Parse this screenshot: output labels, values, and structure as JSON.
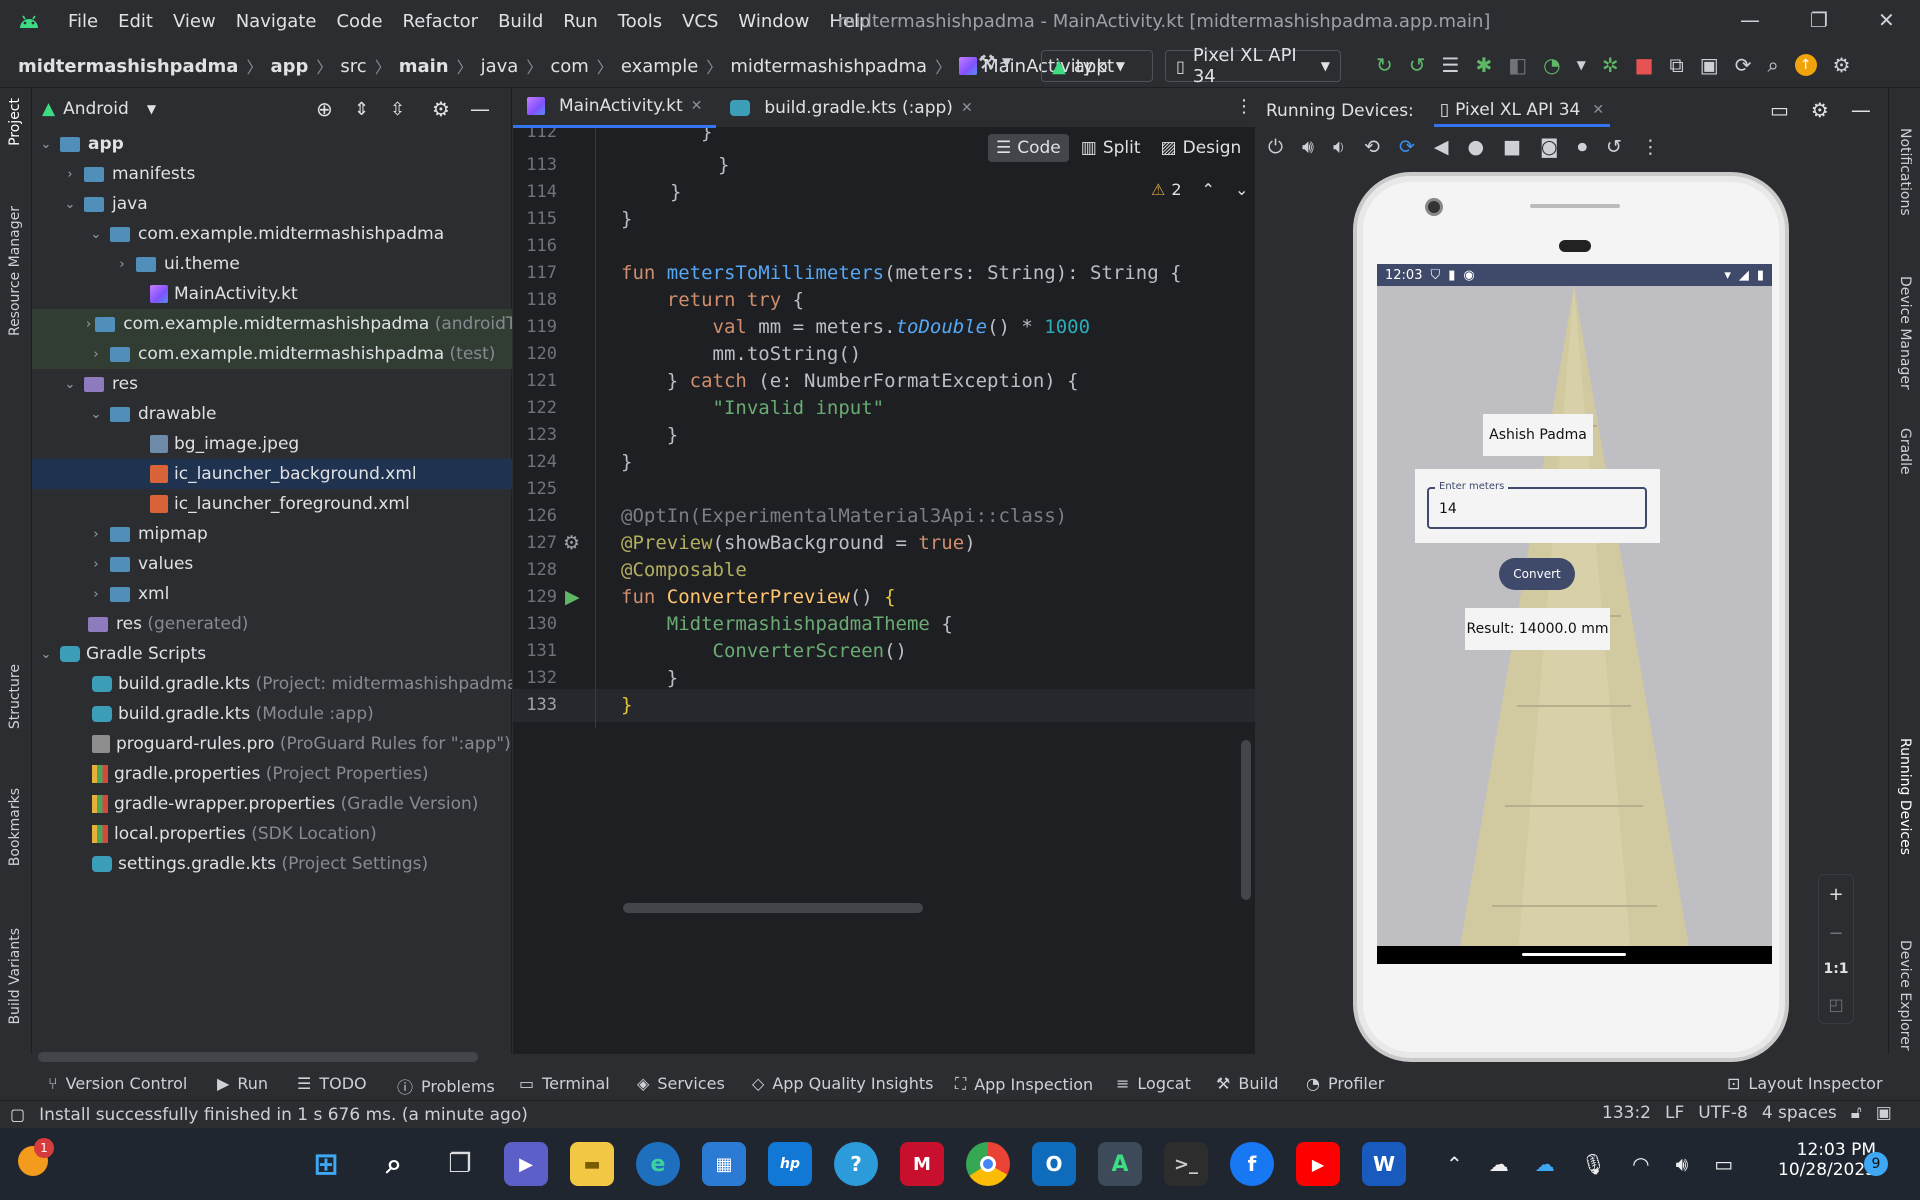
{
  "window": {
    "title": "midtermashishpadma - MainActivity.kt [midtermashishpadma.app.main]",
    "menu": [
      "File",
      "Edit",
      "View",
      "Navigate",
      "Code",
      "Refactor",
      "Build",
      "Run",
      "Tools",
      "VCS",
      "Window",
      "Help"
    ]
  },
  "breadcrumb": [
    "midtermashishpadma",
    "app",
    "src",
    "main",
    "java",
    "com",
    "example",
    "midtermashishpadma",
    "MainActivity.kt"
  ],
  "toolbar": {
    "run_config": "app",
    "device": "Pixel XL API 34"
  },
  "left_strip": [
    "Project",
    "Resource Manager",
    "Structure",
    "Bookmarks",
    "Build Variants"
  ],
  "right_strip": [
    "Notifications",
    "Device Manager",
    "Gradle",
    "Running Devices",
    "Device Explorer"
  ],
  "project": {
    "view": "Android",
    "rows": [
      {
        "label": "app",
        "note": ""
      },
      {
        "label": "manifests",
        "note": ""
      },
      {
        "label": "java",
        "note": ""
      },
      {
        "label": "com.example.midtermashishpadma",
        "note": ""
      },
      {
        "label": "ui.theme",
        "note": ""
      },
      {
        "label": "MainActivity.kt",
        "note": ""
      },
      {
        "label": "com.example.midtermashishpadma",
        "note": "(androidT"
      },
      {
        "label": "com.example.midtermashishpadma",
        "note": "(test)"
      },
      {
        "label": "res",
        "note": ""
      },
      {
        "label": "drawable",
        "note": ""
      },
      {
        "label": "bg_image.jpeg",
        "note": ""
      },
      {
        "label": "ic_launcher_background.xml",
        "note": ""
      },
      {
        "label": "ic_launcher_foreground.xml",
        "note": ""
      },
      {
        "label": "mipmap",
        "note": ""
      },
      {
        "label": "values",
        "note": ""
      },
      {
        "label": "xml",
        "note": ""
      },
      {
        "label": "res",
        "note": "(generated)"
      },
      {
        "label": "Gradle Scripts",
        "note": ""
      },
      {
        "label": "build.gradle.kts",
        "note": "(Project: midtermashishpadma)"
      },
      {
        "label": "build.gradle.kts",
        "note": "(Module :app)"
      },
      {
        "label": "proguard-rules.pro",
        "note": "(ProGuard Rules for \":app\")"
      },
      {
        "label": "gradle.properties",
        "note": "(Project Properties)"
      },
      {
        "label": "gradle-wrapper.properties",
        "note": "(Gradle Version)"
      },
      {
        "label": "local.properties",
        "note": "(SDK Location)"
      },
      {
        "label": "settings.gradle.kts",
        "note": "(Project Settings)"
      }
    ]
  },
  "editor": {
    "tabs": [
      "MainActivity.kt",
      "build.gradle.kts (:app)"
    ],
    "modes": [
      "Code",
      "Split",
      "Design"
    ],
    "warnings": "2",
    "line_numbers": [
      "112",
      "113",
      "114",
      "115",
      "116",
      "117",
      "118",
      "119",
      "120",
      "121",
      "122",
      "123",
      "124",
      "125",
      "126",
      "127",
      "128",
      "129",
      "130",
      "131",
      "132",
      "133"
    ]
  },
  "running_devices": {
    "title": "Running Devices:",
    "tab": "Pixel XL API 34",
    "zoom_label": "1:1"
  },
  "app": {
    "time": "12:03",
    "name": "Ashish Padma",
    "input_label": "Enter meters",
    "input_value": "14",
    "button": "Convert",
    "result": "Result: 14000.0 mm"
  },
  "bottom_tools": [
    "Version Control",
    "Run",
    "TODO",
    "Problems",
    "Terminal",
    "Services",
    "App Quality Insights",
    "App Inspection",
    "Logcat",
    "Build",
    "Profiler",
    "Layout Inspector"
  ],
  "status": {
    "message": "Install successfully finished in 1 s 676 ms. (a minute ago)",
    "position": "133:2",
    "line_sep": "LF",
    "encoding": "UTF-8",
    "indent": "4 spaces"
  },
  "taskbar": {
    "time": "12:03 PM",
    "date": "10/28/2023",
    "notif_count": "9",
    "badge": "1"
  }
}
